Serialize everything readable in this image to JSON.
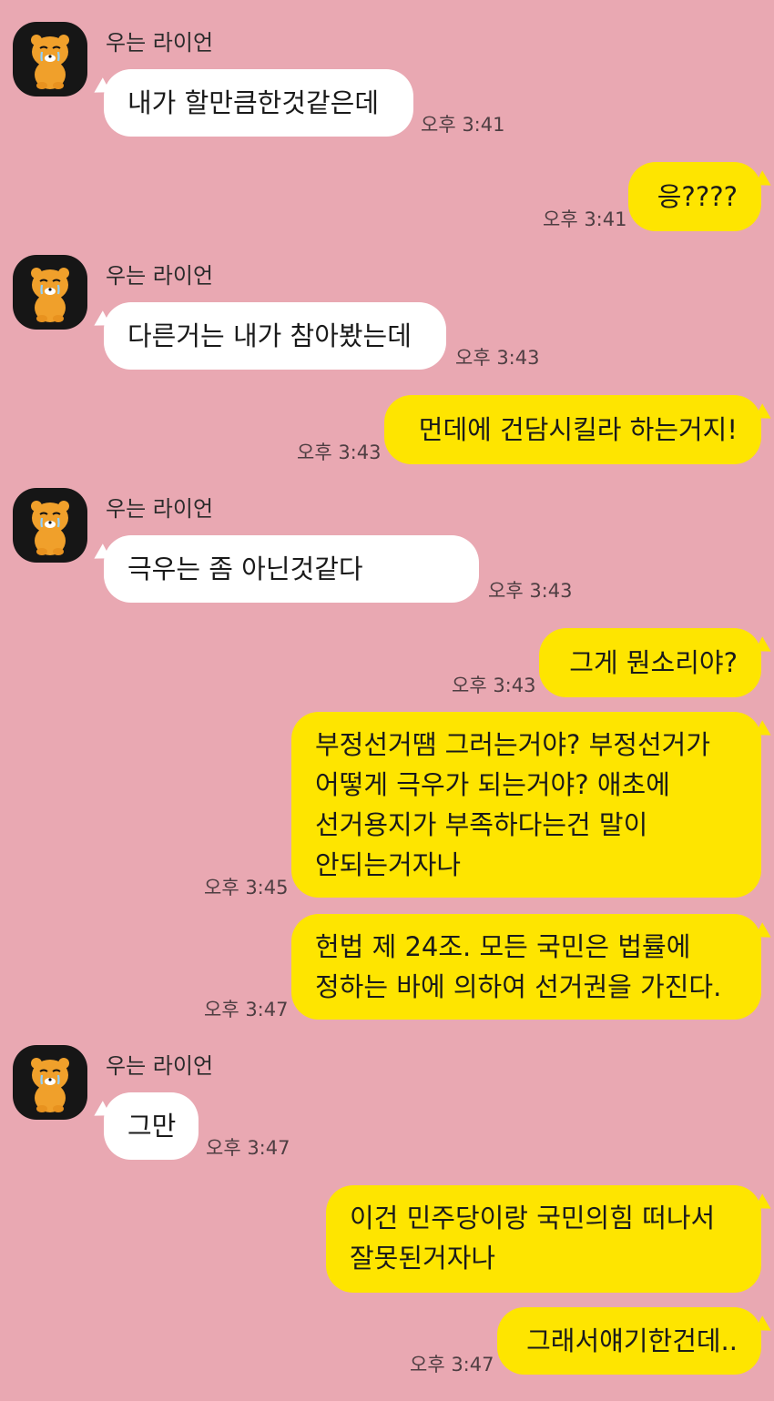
{
  "chat": {
    "partner_name": "우는 라이언",
    "avatar_icon": "crying-ryan-icon",
    "colors": {
      "background": "#e9a8b2",
      "incoming_bubble": "#ffffff",
      "outgoing_bubble": "#fee500"
    },
    "messages": [
      {
        "from": "partner",
        "text": "내가 할만큼한것같은데",
        "time": "오후 3:41"
      },
      {
        "from": "me",
        "text": "응????",
        "time": "오후 3:41"
      },
      {
        "from": "partner",
        "text": "다른거는 내가 참아봤는데",
        "time": "오후 3:43"
      },
      {
        "from": "me",
        "text": "먼데에 건담시킬라 하는거지!",
        "time": "오후 3:43"
      },
      {
        "from": "partner",
        "text": "극우는 좀 아닌것같다",
        "time": "오후 3:43"
      },
      {
        "from": "me",
        "text": "그게 뭔소리야?",
        "time": "오후 3:43"
      },
      {
        "from": "me",
        "lines": [
          "부정선거땜 그러는거야? 부정선거가",
          "어떻게 극우가 되는거야? 애초에",
          "선거용지가 부족하다는건 말이",
          "안되는거자나"
        ],
        "time": "오후 3:45"
      },
      {
        "from": "me",
        "lines": [
          "헌법 제 24조. 모든 국민은 법률에",
          "정하는 바에 의하여 선거권을 가진다."
        ],
        "time": "오후 3:47"
      },
      {
        "from": "partner",
        "text": "그만",
        "time": "오후 3:47"
      },
      {
        "from": "me",
        "lines": [
          "이건 민주당이랑 국민의힘 떠나서",
          "잘못된거자나"
        ]
      },
      {
        "from": "me",
        "text": "그래서얘기한건데..",
        "time": "오후 3:47"
      }
    ]
  }
}
